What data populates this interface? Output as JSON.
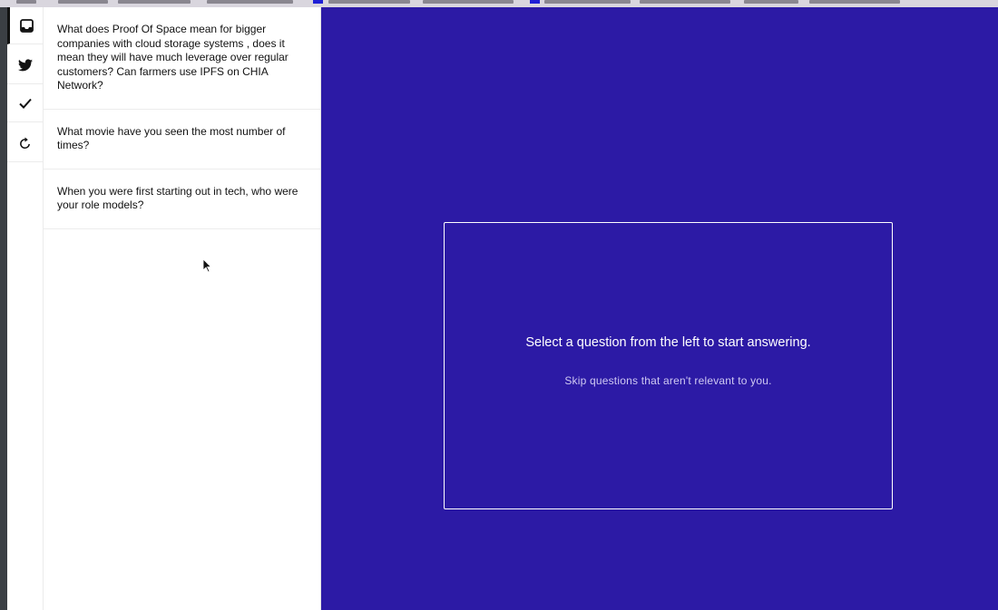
{
  "rail": {
    "items": [
      {
        "name": "inbox",
        "active": true
      },
      {
        "name": "twitter",
        "active": false
      },
      {
        "name": "answered",
        "active": false
      },
      {
        "name": "refresh",
        "active": false
      }
    ]
  },
  "questions": [
    {
      "text": "What does Proof Of Space mean for bigger companies with cloud storage systems , does it mean they will have much leverage over regular customers? Can farmers use IPFS on CHIA Network?"
    },
    {
      "text": "What movie have you seen the most number of times?"
    },
    {
      "text": "When you were first starting out in tech, who were your role models?"
    }
  ],
  "panel": {
    "title": "Select a question from the left to start answering.",
    "subtitle": "Skip questions that aren't relevant to you."
  },
  "colors": {
    "background": "#2c1aa5",
    "sidebar": "#ffffff",
    "panel_border": "#ffffff"
  }
}
